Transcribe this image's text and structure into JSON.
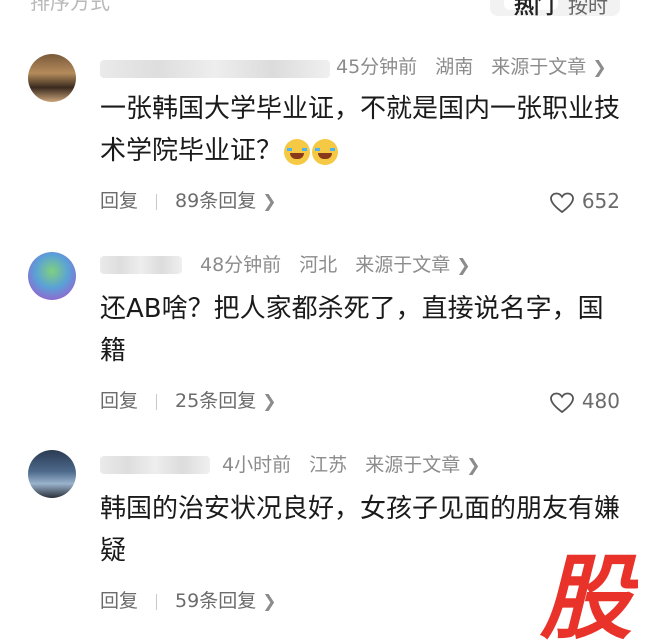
{
  "header": {
    "sort_label": "排序方式",
    "tabs": [
      "热门",
      "按时"
    ]
  },
  "comments": [
    {
      "username": "",
      "time": "45分钟前",
      "location": "湖南",
      "source": "来源于文章",
      "text": "一张韩国大学毕业证，不就是国内一张职业技术学院毕业证？",
      "reply_label": "回复",
      "replies": "89条回复",
      "likes": "652"
    },
    {
      "username": "",
      "time": "48分钟前",
      "location": "河北",
      "source": "来源于文章",
      "text": "还AB啥？把人家都杀死了，直接说名字，国籍",
      "reply_label": "回复",
      "replies": "25条回复",
      "likes": "480"
    },
    {
      "username": "",
      "time": "4小时前",
      "location": "江苏",
      "source": "来源于文章",
      "text": "韩国的治安状况良好，女孩子见面的朋友有嫌疑",
      "reply_label": "回复",
      "replies": "59条回复",
      "likes": ""
    }
  ],
  "watermark": {
    "text": "股",
    "color": "#e8322a"
  },
  "colors": {
    "meta": "#8c8c8c",
    "text": "#1a1a1a",
    "action": "#6b6b6b"
  }
}
